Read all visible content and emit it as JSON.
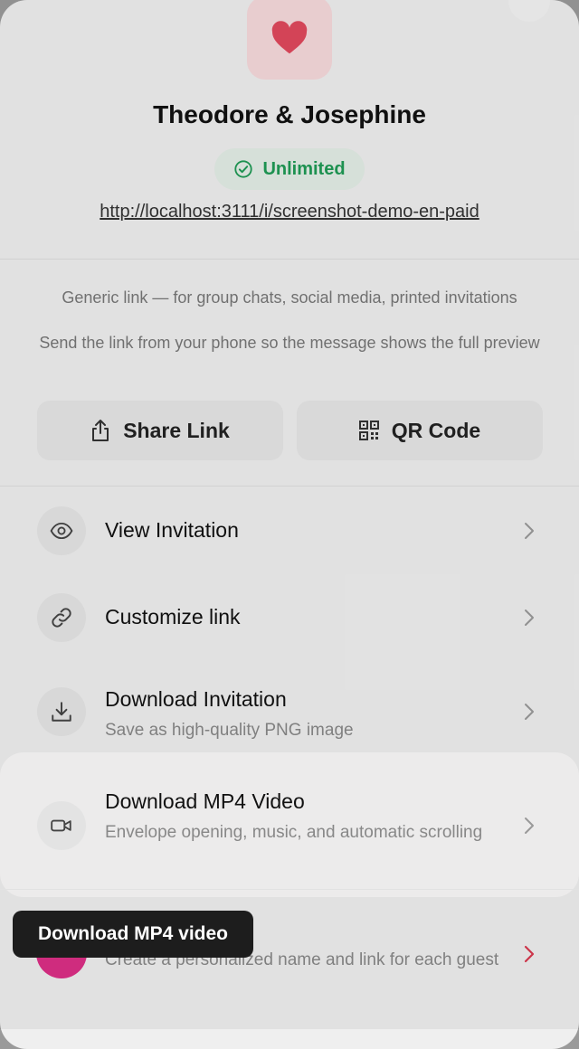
{
  "header": {
    "title": "Theodore & Josephine",
    "badge": "Unlimited",
    "url": "http://localhost:3111/i/screenshot-demo-en-paid"
  },
  "share": {
    "hint_generic": "Generic link — for group chats, social media, printed invitations",
    "hint_phone": "Send the link from your phone so the message shows the full preview",
    "share_label": "Share Link",
    "qr_label": "QR Code"
  },
  "menu": {
    "view": {
      "title": "View Invitation"
    },
    "customize": {
      "title": "Customize link"
    },
    "download": {
      "title": "Download Invitation",
      "subtitle": "Save as high-quality PNG image"
    },
    "video": {
      "title": "Download MP4 Video",
      "subtitle": "Envelope opening, music, and automatic scrolling"
    },
    "guest": {
      "subtitle": "Create a personalized name and link for each guest"
    }
  },
  "tooltip": {
    "text": "Download MP4 video"
  },
  "colors": {
    "accent_green": "#1f9a55",
    "heart_red": "#e0485d",
    "guest_pink": "#e0307a",
    "chevron_red": "#d8394f"
  },
  "icons": [
    "heart-icon",
    "check-circle-icon",
    "share-icon",
    "qr-code-icon",
    "eye-icon",
    "link-icon",
    "download-icon",
    "video-camera-icon",
    "chevron-right-icon"
  ]
}
